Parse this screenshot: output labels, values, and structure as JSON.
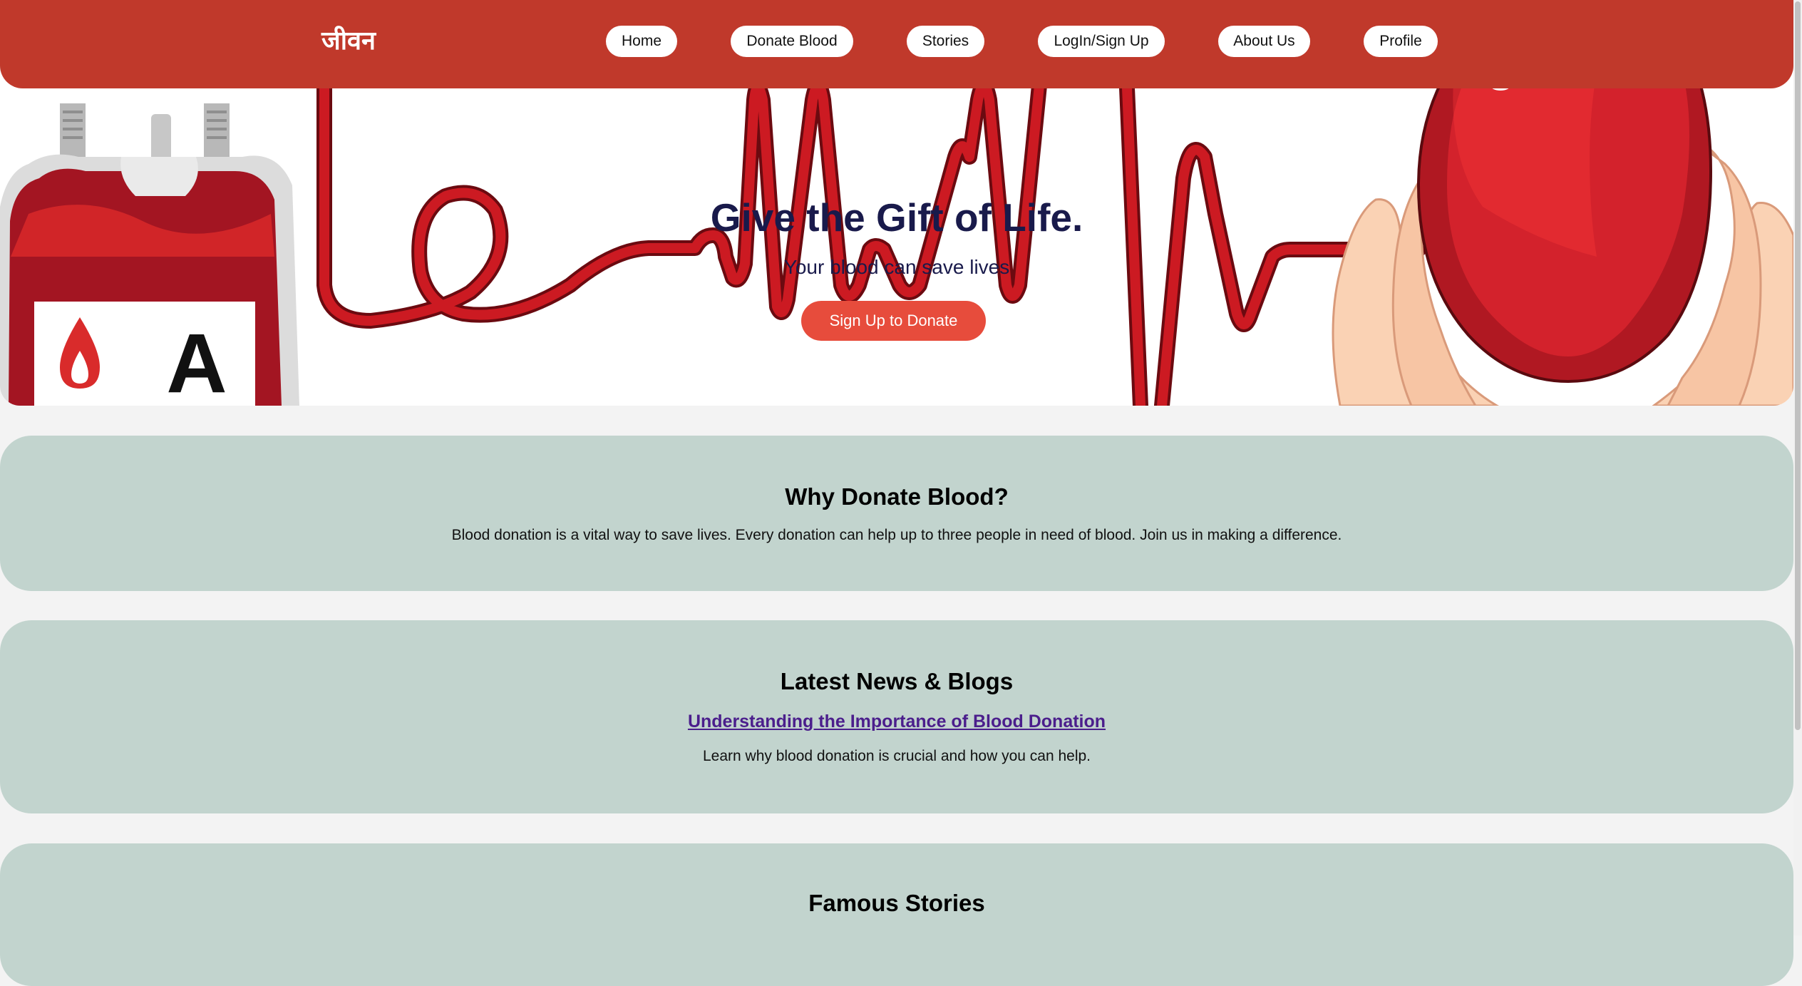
{
  "header": {
    "brand": "जीवन",
    "nav": [
      {
        "label": "Home"
      },
      {
        "label": "Donate Blood"
      },
      {
        "label": "Stories"
      },
      {
        "label": "LogIn/Sign Up"
      },
      {
        "label": "About Us"
      },
      {
        "label": "Profile"
      }
    ]
  },
  "hero": {
    "title": "Give the Gift of Life.",
    "subtitle": "Your blood can save lives",
    "cta_label": "Sign Up to Donate",
    "blood_bag_label": "A"
  },
  "why": {
    "heading": "Why Donate Blood?",
    "text": "Blood donation is a vital way to save lives. Every donation can help up to three people in need of blood. Join us in making a difference."
  },
  "news": {
    "heading": "Latest News & Blogs",
    "article_title": "Understanding the Importance of Blood Donation",
    "article_summary": "Learn why blood donation is crucial and how you can help."
  },
  "stories": {
    "heading": "Famous Stories"
  },
  "colors": {
    "header_red": "#c0392b",
    "cta_red": "#e74c3c",
    "card_bg": "#c2d4ce",
    "page_bg": "#f3f3f3",
    "title_navy": "#191a4b",
    "link_purple": "#4b1e8c"
  }
}
